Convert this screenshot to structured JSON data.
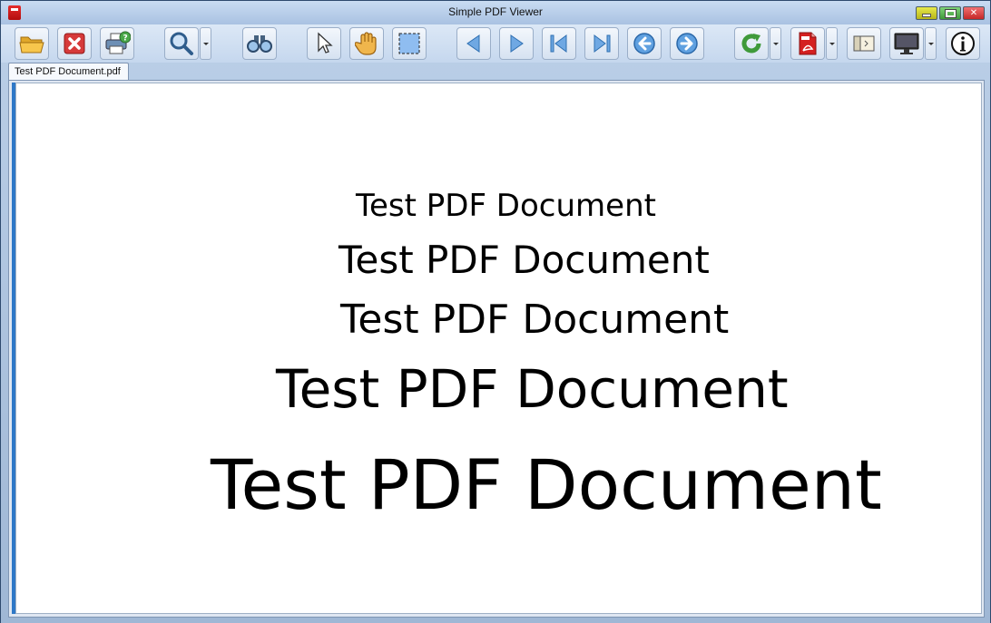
{
  "window": {
    "title": "Simple PDF Viewer"
  },
  "tabs": [
    {
      "label": "Test PDF Document.pdf",
      "active": true
    }
  ],
  "toolbar": {
    "buttons": [
      {
        "name": "open",
        "icon": "open-folder-icon"
      },
      {
        "name": "close",
        "icon": "close-x-icon"
      },
      {
        "name": "print",
        "icon": "printer-icon"
      },
      {
        "name": "zoom",
        "icon": "magnifier-icon",
        "has_dropdown": true
      },
      {
        "name": "find",
        "icon": "binoculars-icon"
      },
      {
        "name": "select",
        "icon": "cursor-arrow-icon"
      },
      {
        "name": "hand",
        "icon": "hand-pan-icon"
      },
      {
        "name": "marquee",
        "icon": "marquee-select-icon"
      },
      {
        "name": "previous-page",
        "icon": "triangle-left-icon"
      },
      {
        "name": "next-page",
        "icon": "triangle-right-icon"
      },
      {
        "name": "first-page",
        "icon": "first-page-icon"
      },
      {
        "name": "last-page",
        "icon": "last-page-icon"
      },
      {
        "name": "back",
        "icon": "circle-arrow-left-icon"
      },
      {
        "name": "forward",
        "icon": "circle-arrow-right-icon"
      },
      {
        "name": "rotate",
        "icon": "rotate-refresh-icon",
        "has_dropdown": true
      },
      {
        "name": "pdf-options",
        "icon": "pdf-file-icon",
        "has_dropdown": true
      },
      {
        "name": "sidebar-toggle",
        "icon": "sidebar-panel-icon"
      },
      {
        "name": "display-mode",
        "icon": "monitor-icon",
        "has_dropdown": true
      },
      {
        "name": "about",
        "icon": "info-icon"
      }
    ]
  },
  "document": {
    "lines": [
      "Test PDF Document",
      "Test PDF Document",
      "Test PDF Document",
      "Test PDF Document",
      "Test PDF Document"
    ]
  },
  "colors": {
    "accent_blue": "#2e78c7",
    "close_red": "#c52828",
    "pdf_red": "#d42020",
    "rotate_green": "#3f9a3a"
  }
}
